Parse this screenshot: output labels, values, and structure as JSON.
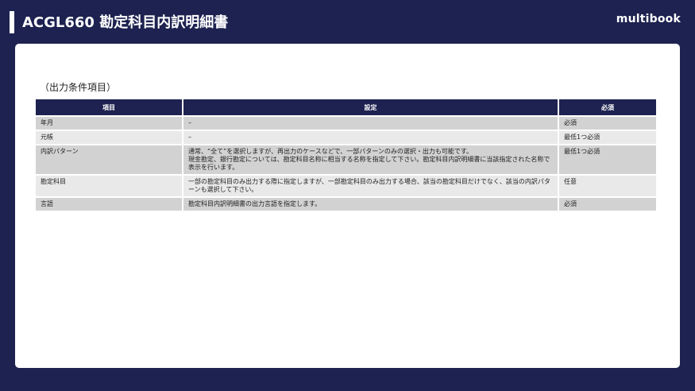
{
  "header": {
    "title": "ACGL660 勘定科目内訳明細書",
    "logo_text": "multibook"
  },
  "section": {
    "title": "（出力条件項目）"
  },
  "table": {
    "columns": [
      "項目",
      "設定",
      "必須"
    ],
    "rows": [
      {
        "item": "年月",
        "setting": [
          "–"
        ],
        "required": "必須"
      },
      {
        "item": "元帳",
        "setting": [
          "–"
        ],
        "required": "最低1つ必須"
      },
      {
        "item": "内訳パターン",
        "setting": [
          "通常、“全て”を選択しますが、再出力のケースなどで、一部パターンのみの選択・出力も可能です。",
          "現金勘定、銀行勘定については、勘定科目名称に相当する名称を指定して下さい。勘定科目内訳明細書に当該指定された名称で表示を行います。"
        ],
        "required": "最低1つ必須"
      },
      {
        "item": "勘定科目",
        "setting": [
          "一部の勘定科目のみ出力する際に指定しますが、一部勘定科目のみ出力する場合、該当の勘定科目だけでなく、該当の内訳パターンも選択して下さい。"
        ],
        "required": "任意"
      },
      {
        "item": "言語",
        "setting": [
          "勘定科目内訳明細書の出力言語を指定します。"
        ],
        "required": "必須"
      }
    ]
  }
}
